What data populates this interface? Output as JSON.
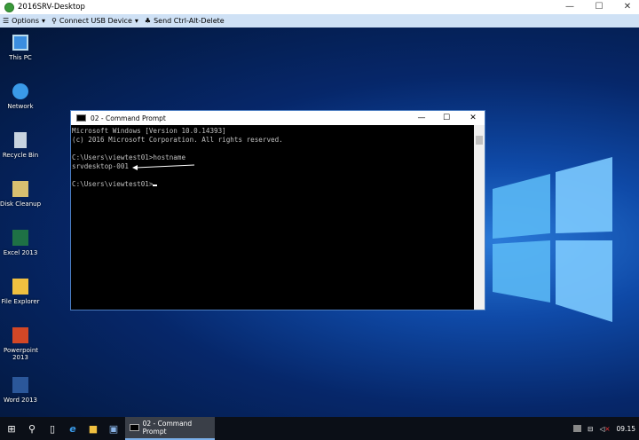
{
  "window": {
    "title": "2016SRV-Desktop",
    "controls": [
      "minimize",
      "maximize",
      "close"
    ]
  },
  "toolbar": {
    "options": "Options",
    "usb": "Connect USB Device",
    "cad": "Send Ctrl-Alt-Delete"
  },
  "desktop_icons": [
    {
      "label": "This PC",
      "icon": "computer-icon"
    },
    {
      "label": "Network",
      "icon": "network-icon"
    },
    {
      "label": "Recycle Bin",
      "icon": "recycle-bin-icon"
    },
    {
      "label": "Disk Cleanup",
      "icon": "disk-cleanup-icon"
    },
    {
      "label": "Excel 2013",
      "icon": "excel-icon"
    },
    {
      "label": "File Explorer",
      "icon": "folder-icon"
    },
    {
      "label": "Powerpoint 2013",
      "icon": "powerpoint-icon"
    },
    {
      "label": "Word 2013",
      "icon": "word-icon"
    }
  ],
  "cmd": {
    "title": "02 - Command Prompt",
    "lines": [
      "Microsoft Windows [Version 10.0.14393]",
      "(c) 2016 Microsoft Corporation. All rights reserved.",
      "",
      "C:\\Users\\viewtest01>hostname",
      "srvdesktop-001",
      "",
      "C:\\Users\\viewtest01>"
    ]
  },
  "taskbar": {
    "task": "02 - Command Prompt",
    "clock": "09.15"
  }
}
